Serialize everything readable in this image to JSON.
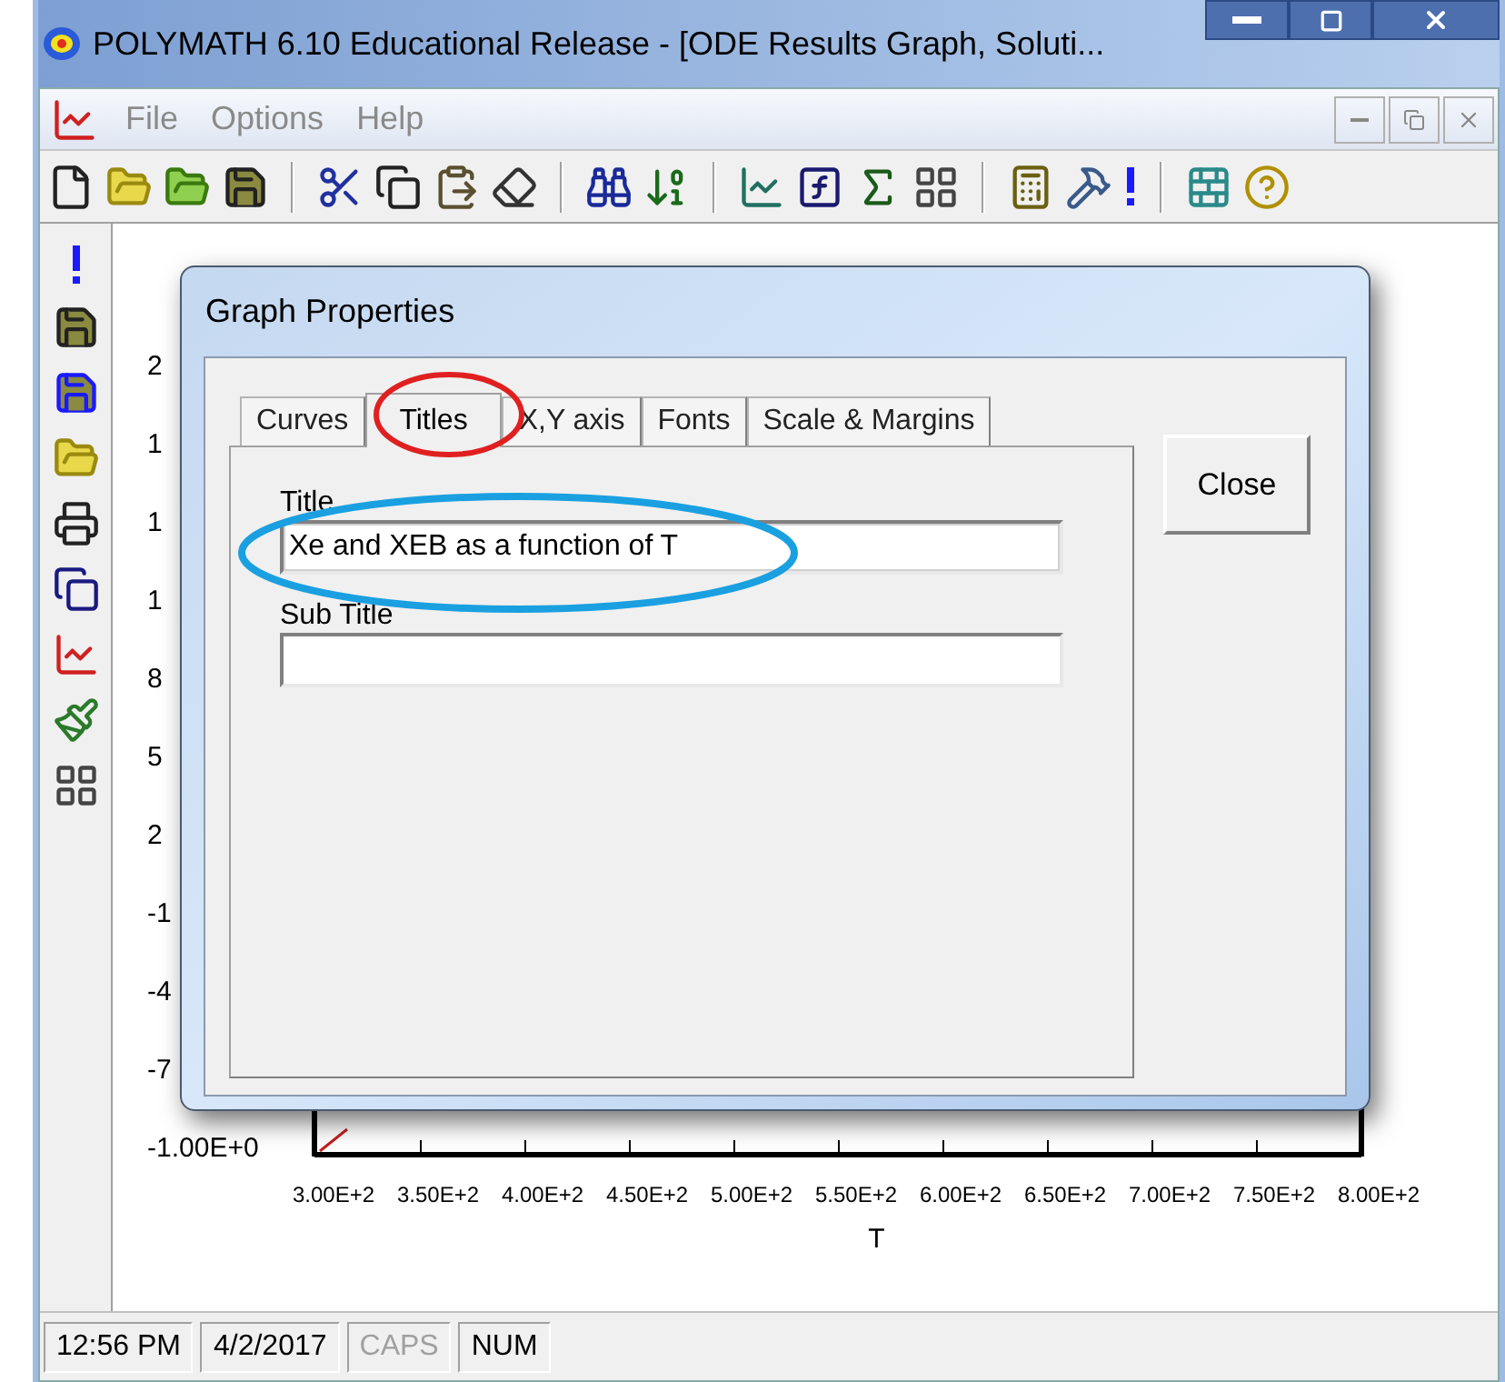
{
  "window": {
    "title": "POLYMATH 6.10 Educational Release - [ODE Results Graph, Soluti..."
  },
  "menu": [
    "File",
    "Options",
    "Help"
  ],
  "graph": {
    "y_ticks": [
      "2",
      "1",
      "1",
      "1",
      "8",
      "5",
      "2",
      "-1",
      "-4",
      "-7",
      "-1.00E+0"
    ],
    "x_ticks": [
      "3.00E+2",
      "3.50E+2",
      "4.00E+2",
      "4.50E+2",
      "5.00E+2",
      "5.50E+2",
      "6.00E+2",
      "6.50E+2",
      "7.00E+2",
      "7.50E+2",
      "8.00E+2"
    ],
    "xlabel": "T"
  },
  "dialog": {
    "title": "Graph Properties",
    "tabs": [
      {
        "label": "Curves",
        "selected": false
      },
      {
        "label": "Titles",
        "selected": true
      },
      {
        "label": "X,Y axis",
        "selected": false
      },
      {
        "label": "Fonts",
        "selected": false
      },
      {
        "label": "Scale & Margins",
        "selected": false
      }
    ],
    "fields": [
      {
        "label": "Title",
        "value": "Xe and XEB as a function of T",
        "focused": true
      },
      {
        "label": "Sub Title",
        "focused": false
      }
    ],
    "close_button": "Close"
  },
  "status_bar": [
    {
      "text": "12:56 PM",
      "disabled": false
    },
    {
      "text": "4/2/2017",
      "disabled": false
    },
    {
      "text": "CAPS",
      "disabled": true
    },
    {
      "text": "NUM",
      "disabled": false
    }
  ]
}
